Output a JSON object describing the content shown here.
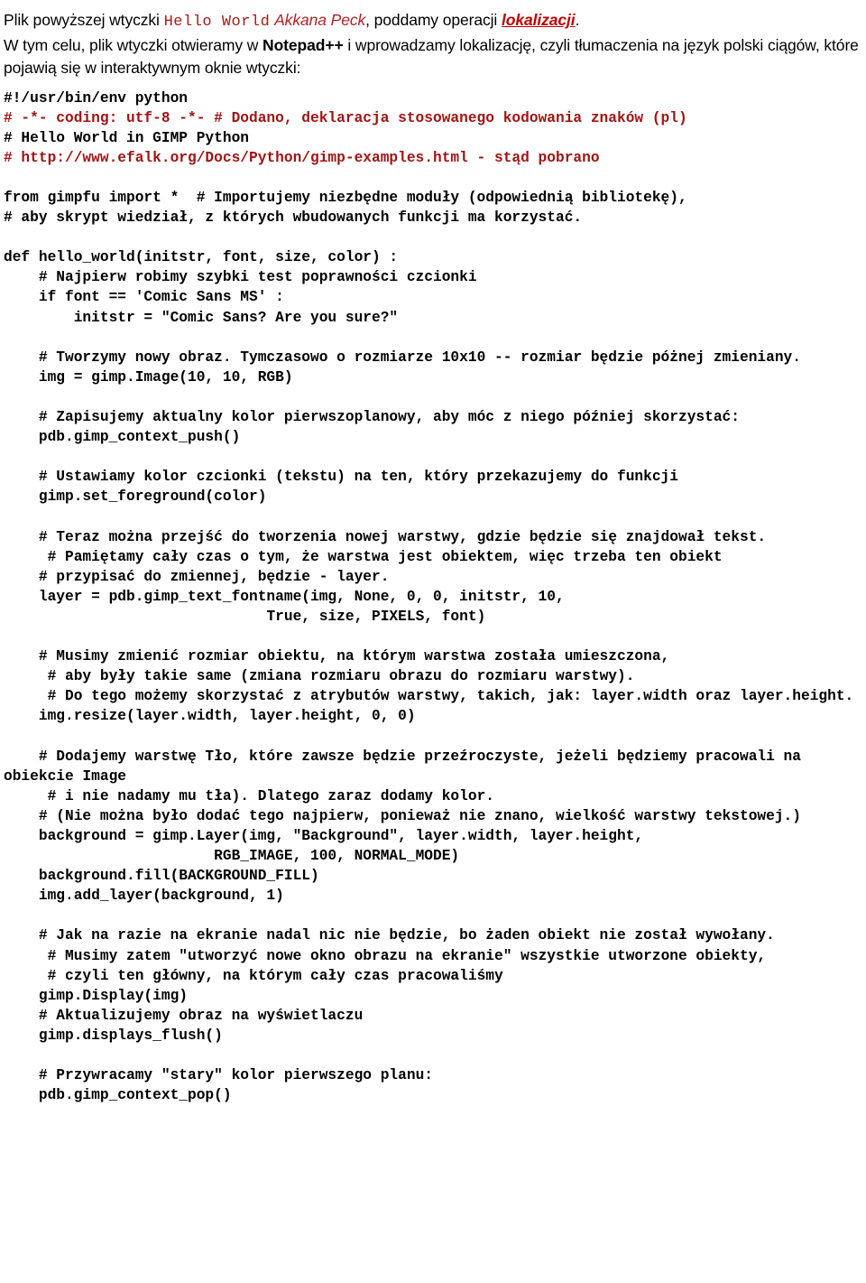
{
  "document": {
    "language": "pl",
    "colors": {
      "text": "#000000",
      "accent_red": "#a01414",
      "heading_red": "#c00000"
    },
    "intro": {
      "line1": {
        "seg1": "Plik powyższej wtyczki ",
        "seg2_mono_red": "Hello World",
        "seg3": " ",
        "seg4_italic_red": "Akkana Peck",
        "seg5": ", poddamy operacji ",
        "seg6_bold_italic_red_underline": "lokalizacji",
        "seg7": "."
      },
      "line2": {
        "seg1": "W tym celu, plik wtyczki otwieramy w ",
        "seg2_bold": "Notepad++",
        "seg3": " i wprowadzamy  lokalizację, czyli tłumaczenia na język polski ciągów, które pojawią się w interaktywnym oknie wtyczki:"
      }
    },
    "code": {
      "lines": [
        {
          "text": "#!/usr/bin/env python",
          "color": "black"
        },
        {
          "text": "# -*- coding: utf-8 -*- # Dodano, deklaracja stosowanego kodowania znaków (pl)",
          "color": "red"
        },
        {
          "text": "# Hello World in GIMP Python",
          "color": "black"
        },
        {
          "text": "# http://www.efalk.org/Docs/Python/gimp-examples.html - stąd pobrano",
          "color": "red"
        },
        {
          "text": "",
          "color": "black"
        },
        {
          "text": "from gimpfu import *  # Importujemy niezbędne moduły (odpowiednią bibliotekę),",
          "color": "black"
        },
        {
          "text": "# aby skrypt wiedział, z których wbudowanych funkcji ma korzystać.",
          "color": "black"
        },
        {
          "text": "",
          "color": "black"
        },
        {
          "text": "def hello_world(initstr, font, size, color) :",
          "color": "black"
        },
        {
          "text": "    # Najpierw robimy szybki test poprawności czcionki",
          "color": "black"
        },
        {
          "text": "    if font == 'Comic Sans MS' :",
          "color": "black"
        },
        {
          "text": "        initstr = \"Comic Sans? Are you sure?\"",
          "color": "black"
        },
        {
          "text": "",
          "color": "black"
        },
        {
          "text": "    # Tworzymy nowy obraz. Tymczasowo o rozmiarze 10x10 -- rozmiar będzie póżnej zmieniany.",
          "color": "black"
        },
        {
          "text": "    img = gimp.Image(10, 10, RGB)",
          "color": "black"
        },
        {
          "text": "",
          "color": "black"
        },
        {
          "text": "    # Zapisujemy aktualny kolor pierwszoplanowy, aby móc z niego później skorzystać:",
          "color": "black"
        },
        {
          "text": "    pdb.gimp_context_push()",
          "color": "black"
        },
        {
          "text": "",
          "color": "black"
        },
        {
          "text": "    # Ustawiamy kolor czcionki (tekstu) na ten, który przekazujemy do funkcji",
          "color": "black"
        },
        {
          "text": "    gimp.set_foreground(color)",
          "color": "black"
        },
        {
          "text": "",
          "color": "black"
        },
        {
          "text": "    # Teraz można przejść do tworzenia nowej warstwy, gdzie będzie się znajdował tekst.",
          "color": "black"
        },
        {
          "text": "     # Pamiętamy cały czas o tym, że warstwa jest obiektem, więc trzeba ten obiekt",
          "color": "black"
        },
        {
          "text": "    # przypisać do zmiennej, będzie - layer.",
          "color": "black"
        },
        {
          "text": "    layer = pdb.gimp_text_fontname(img, None, 0, 0, initstr, 10,",
          "color": "black"
        },
        {
          "text": "                              True, size, PIXELS, font)",
          "color": "black"
        },
        {
          "text": "",
          "color": "black"
        },
        {
          "text": "    # Musimy zmienić rozmiar obiektu, na którym warstwa została umieszczona,",
          "color": "black"
        },
        {
          "text": "     # aby były takie same (zmiana rozmiaru obrazu do rozmiaru warstwy).",
          "color": "black"
        },
        {
          "text": "     # Do tego możemy skorzystać z atrybutów warstwy, takich, jak: layer.width oraz layer.height.",
          "color": "black"
        },
        {
          "text": "    img.resize(layer.width, layer.height, 0, 0)",
          "color": "black"
        },
        {
          "text": "",
          "color": "black"
        },
        {
          "text": "    # Dodajemy warstwę Tło, które zawsze będzie przeźroczyste, jeżeli będziemy pracowali na obiekcie Image",
          "color": "black"
        },
        {
          "text": "     # i nie nadamy mu tła). Dlatego zaraz dodamy kolor.",
          "color": "black"
        },
        {
          "text": "    # (Nie można było dodać tego najpierw, ponieważ nie znano, wielkość warstwy tekstowej.)",
          "color": "black"
        },
        {
          "text": "    background = gimp.Layer(img, \"Background\", layer.width, layer.height,",
          "color": "black"
        },
        {
          "text": "                        RGB_IMAGE, 100, NORMAL_MODE)",
          "color": "black"
        },
        {
          "text": "    background.fill(BACKGROUND_FILL)",
          "color": "black"
        },
        {
          "text": "    img.add_layer(background, 1)",
          "color": "black"
        },
        {
          "text": "",
          "color": "black"
        },
        {
          "text": "    # Jak na razie na ekranie nadal nic nie będzie, bo żaden obiekt nie został wywołany.",
          "color": "black"
        },
        {
          "text": "     # Musimy zatem \"utworzyć nowe okno obrazu na ekranie\" wszystkie utworzone obiekty,",
          "color": "black"
        },
        {
          "text": "     # czyli ten główny, na którym cały czas pracowaliśmy",
          "color": "black"
        },
        {
          "text": "    gimp.Display(img)",
          "color": "black"
        },
        {
          "text": "    # Aktualizujemy obraz na wyświetlaczu",
          "color": "black"
        },
        {
          "text": "    gimp.displays_flush()",
          "color": "black"
        },
        {
          "text": "",
          "color": "black"
        },
        {
          "text": "    # Przywracamy \"stary\" kolor pierwszego planu:",
          "color": "black"
        },
        {
          "text": "    pdb.gimp_context_pop()",
          "color": "black"
        }
      ]
    }
  }
}
